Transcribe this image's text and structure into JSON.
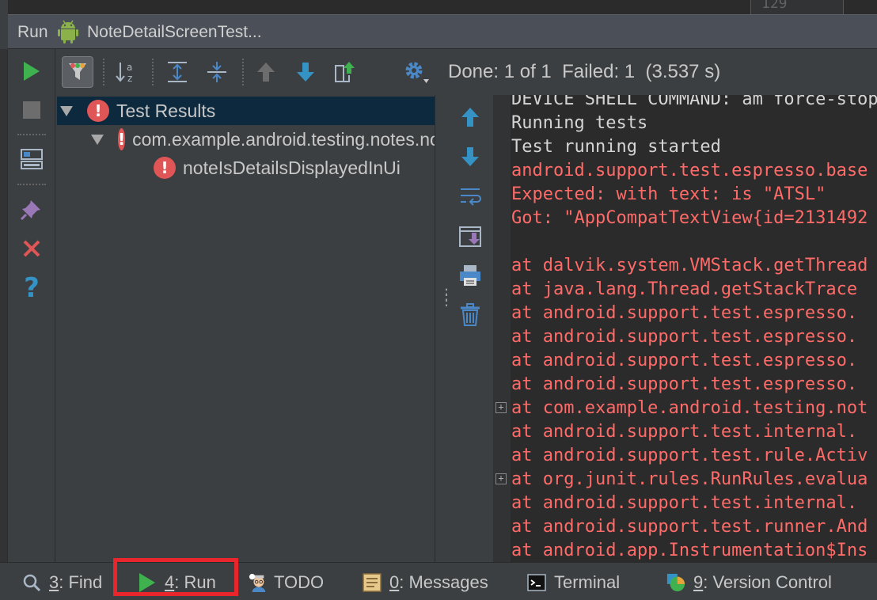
{
  "editor": {
    "line_number": "129"
  },
  "run_window": {
    "title": "Run",
    "config_name": "NoteDetailScreenTest...",
    "status": "Done: 1 of 1  Failed: 1  (3.537 s)"
  },
  "toolbar": {
    "left_buttons": [
      "rerun-icon",
      "stop-icon",
      "layout-icon",
      "pin-icon",
      "close-icon",
      "help-icon"
    ],
    "top_buttons": [
      "filter-icon",
      "sort-alpha-icon",
      "expand-all-icon",
      "collapse-all-icon",
      "previous-icon",
      "next-icon",
      "export-icon",
      "settings-icon"
    ]
  },
  "tree": {
    "root": "Test Results",
    "class_node": "com.example.android.testing.notes.notedetail.NoteDetailScreenTest",
    "method_node": "noteIsDetailsDisplayedInUi"
  },
  "console": {
    "lines": [
      {
        "text": "DEVICE SHELL COMMAND: am force-stop",
        "kind": "normal"
      },
      {
        "text": "Running tests",
        "kind": "normal"
      },
      {
        "text": "Test running started",
        "kind": "normal"
      },
      {
        "text": "android.support.test.espresso.base",
        "kind": "error"
      },
      {
        "text": "Expected: with text: is \"ATSL\"",
        "kind": "error"
      },
      {
        "text": "Got: \"AppCompatTextView{id=2131492",
        "kind": "error"
      },
      {
        "text": "",
        "kind": "error"
      },
      {
        "text": "at dalvik.system.VMStack.getThread",
        "kind": "error"
      },
      {
        "text": "at java.lang.Thread.getStackTrace",
        "kind": "error"
      },
      {
        "text": "at android.support.test.espresso.",
        "kind": "error"
      },
      {
        "text": "at android.support.test.espresso.",
        "kind": "error"
      },
      {
        "text": "at android.support.test.espresso.",
        "kind": "error"
      },
      {
        "text": "at android.support.test.espresso.",
        "kind": "error"
      },
      {
        "text": "at com.example.android.testing.not",
        "kind": "error"
      },
      {
        "text": "at android.support.test.internal.",
        "kind": "error"
      },
      {
        "text": "at android.support.test.rule.Activ",
        "kind": "error"
      },
      {
        "text": "at org.junit.rules.RunRules.evalua",
        "kind": "error"
      },
      {
        "text": "at android.support.test.internal.",
        "kind": "error"
      },
      {
        "text": "at android.support.test.runner.And",
        "kind": "error"
      },
      {
        "text": "at android.app.Instrumentation$Ins",
        "kind": "error"
      }
    ],
    "colors": {
      "normal": "#d4d4d4",
      "error": "#ff6b68"
    }
  },
  "bottom_bar": {
    "find": {
      "num": "3",
      "label": ": Find"
    },
    "run": {
      "num": "4",
      "label": ": Run"
    },
    "todo": {
      "label": "TODO"
    },
    "messages": {
      "num": "0",
      "label": ": Messages"
    },
    "terminal": {
      "label": "Terminal"
    },
    "vcs": {
      "num": "9",
      "label": ": Version Control"
    }
  },
  "colors": {
    "accent_highlight": "#e8262b",
    "run_green": "#3fb24f",
    "error_red": "#e05555",
    "nav_blue": "#3592c4"
  }
}
